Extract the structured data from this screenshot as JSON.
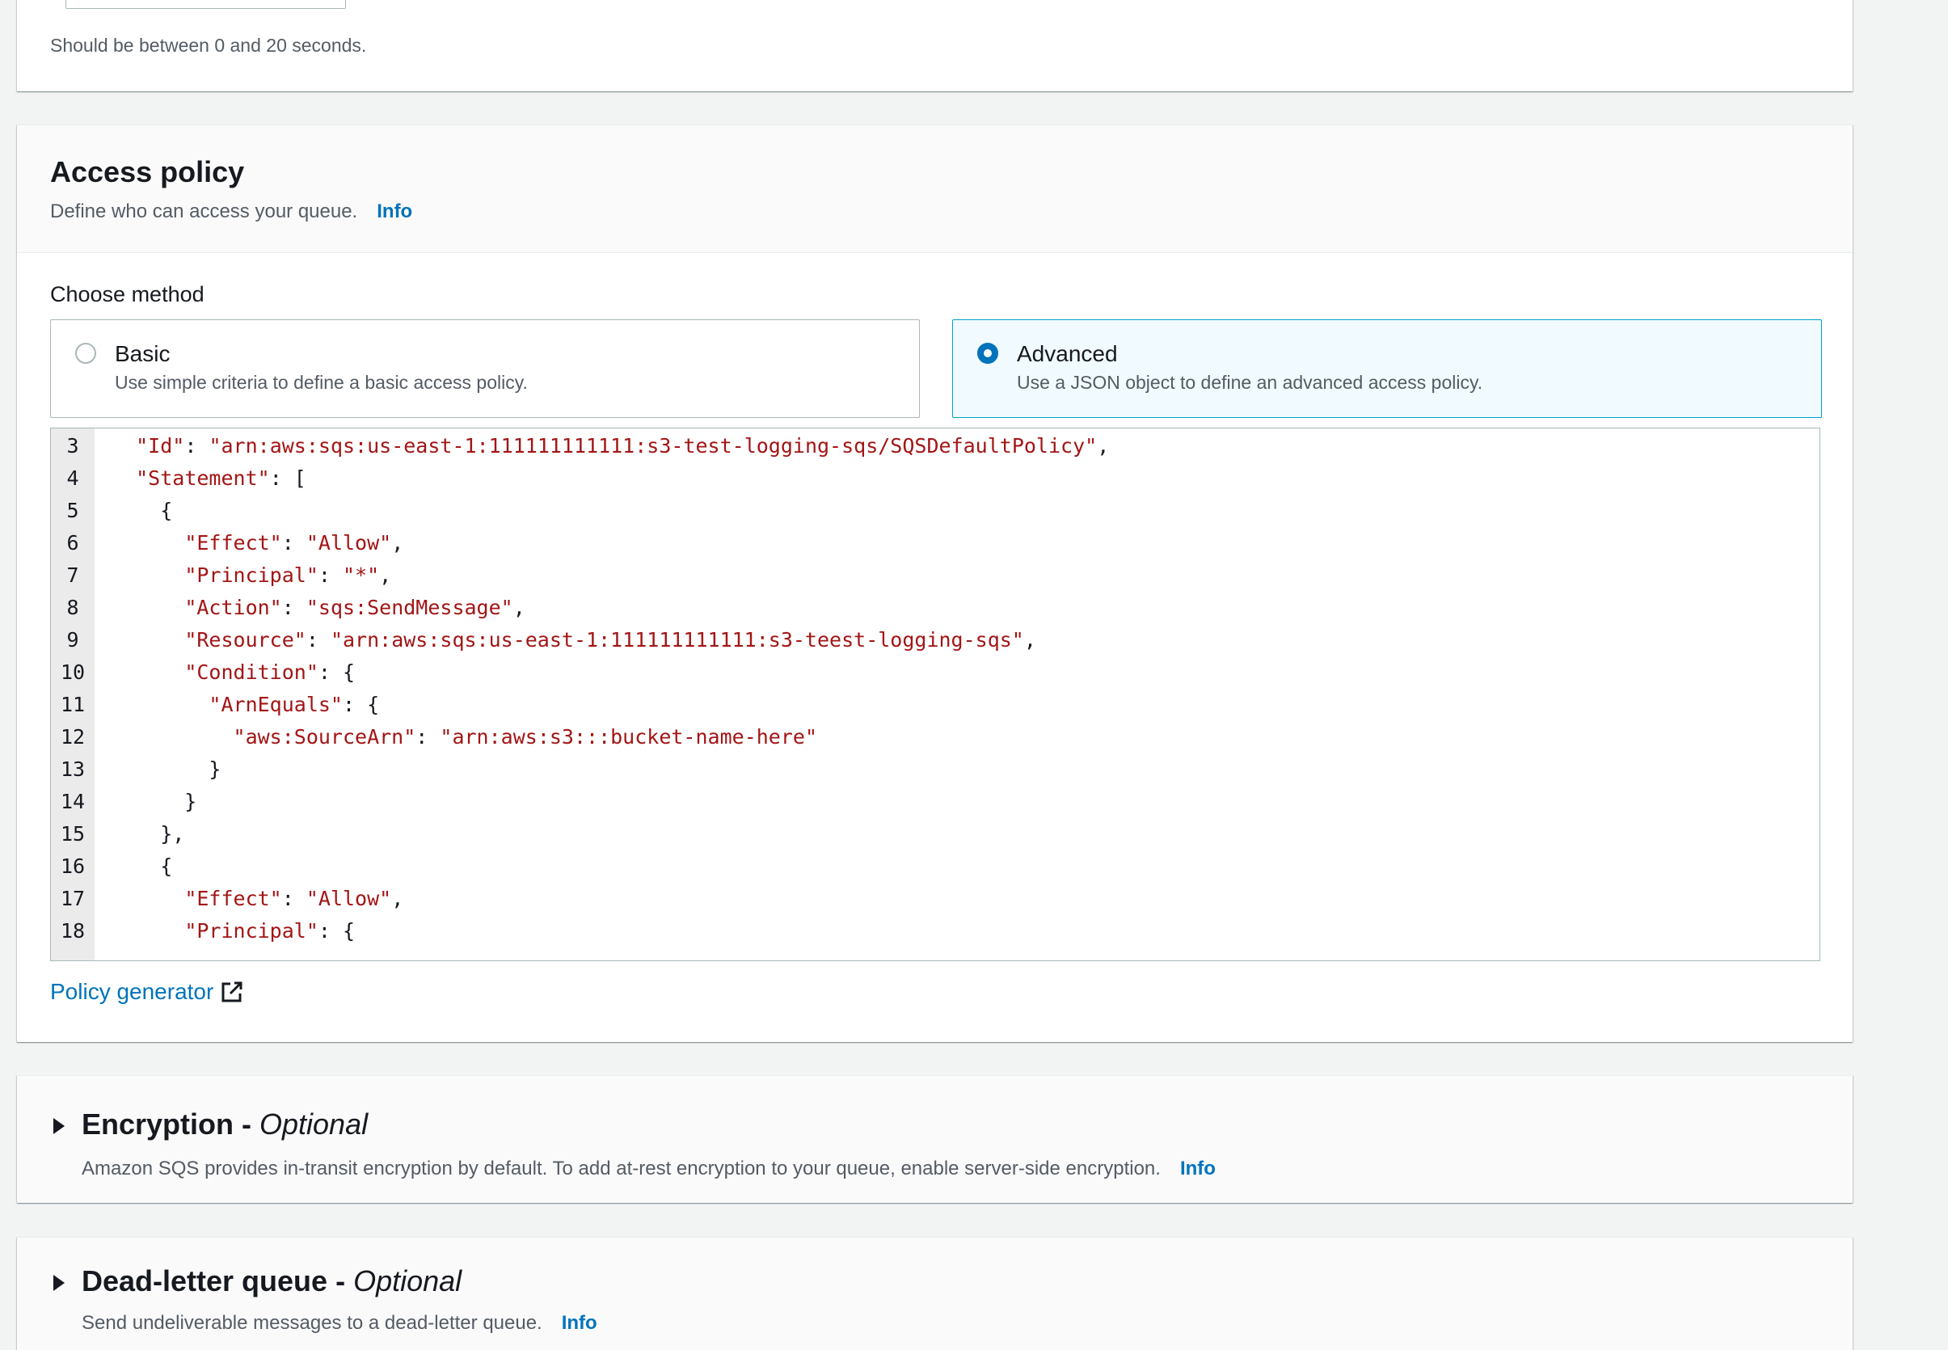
{
  "top_section": {
    "hint": "Should be between 0 and 20 seconds."
  },
  "access_policy": {
    "title": "Access policy",
    "description": "Define who can access your queue.",
    "info_label": "Info",
    "choose_method_label": "Choose method",
    "options": [
      {
        "title": "Basic",
        "description": "Use simple criteria to define a basic access policy.",
        "selected": false
      },
      {
        "title": "Advanced",
        "description": "Use a JSON object to define an advanced access policy.",
        "selected": true
      }
    ],
    "editor": {
      "lines": [
        {
          "num": "3",
          "text": "  \"Id\": \"arn:aws:sqs:us-east-1:111111111111:s3-test-logging-sqs/SQSDefaultPolicy\","
        },
        {
          "num": "4",
          "text": "  \"Statement\": ["
        },
        {
          "num": "5",
          "text": "    {"
        },
        {
          "num": "6",
          "text": "      \"Effect\": \"Allow\","
        },
        {
          "num": "7",
          "text": "      \"Principal\": \"*\","
        },
        {
          "num": "8",
          "text": "      \"Action\": \"sqs:SendMessage\","
        },
        {
          "num": "9",
          "text": "      \"Resource\": \"arn:aws:sqs:us-east-1:111111111111:s3-teest-logging-sqs\","
        },
        {
          "num": "10",
          "text": "      \"Condition\": {"
        },
        {
          "num": "11",
          "text": "        \"ArnEquals\": {"
        },
        {
          "num": "12",
          "text": "          \"aws:SourceArn\": \"arn:aws:s3:::bucket-name-here\""
        },
        {
          "num": "13",
          "text": "        }"
        },
        {
          "num": "14",
          "text": "      }"
        },
        {
          "num": "15",
          "text": "    },"
        },
        {
          "num": "16",
          "text": "    {"
        },
        {
          "num": "17",
          "text": "      \"Effect\": \"Allow\","
        },
        {
          "num": "18",
          "text": "      \"Principal\": {"
        }
      ]
    },
    "policy_generator_label": "Policy generator",
    "policy_generator_icon": "external-link-icon"
  },
  "encryption": {
    "title": "Encryption",
    "optional": "Optional",
    "separator": " - ",
    "description": "Amazon SQS provides in-transit encryption by default. To add at-rest encryption to your queue, enable server-side encryption.",
    "info_label": "Info"
  },
  "dead_letter_queue": {
    "title": "Dead-letter queue",
    "optional": "Optional",
    "separator": " - ",
    "description": "Send undeliverable messages to a dead-letter queue.",
    "info_label": "Info"
  },
  "colors": {
    "link": "#0073bb",
    "string": "#a31515",
    "selected_bg": "#f1faff",
    "selected_border": "#00a1c9"
  }
}
